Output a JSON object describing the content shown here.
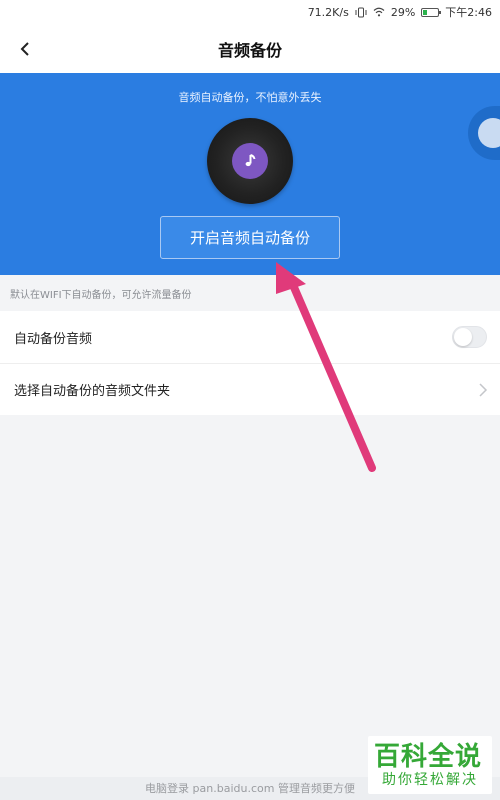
{
  "status_bar": {
    "network_speed": "71.2K/s",
    "battery_percent": "29%",
    "battery_level": 0.29,
    "time": "下午2:46",
    "icons": [
      "vibrate-icon",
      "wifi-icon",
      "battery-icon"
    ]
  },
  "header": {
    "title": "音频备份",
    "back_icon": "chevron-left-icon"
  },
  "hero": {
    "subtitle": "音频自动备份，不怕意外丢失",
    "disc_icon": "music-note-icon",
    "button_label": "开启音频自动备份",
    "bg_color": "#2b7de1",
    "disc_center_color": "#7e57c2"
  },
  "hint": "默认在WIFI下自动备份，可允许流量备份",
  "settings": [
    {
      "label": "自动备份音频",
      "control": "toggle",
      "enabled": false
    },
    {
      "label": "选择自动备份的音频文件夹",
      "control": "chevron-right-icon"
    }
  ],
  "footer": "电脑登录 pan.baidu.com 管理音频更方便",
  "watermark": {
    "title": "百科全说",
    "subtitle": "助你轻松解决"
  },
  "annotation_color": "#e03a7a"
}
